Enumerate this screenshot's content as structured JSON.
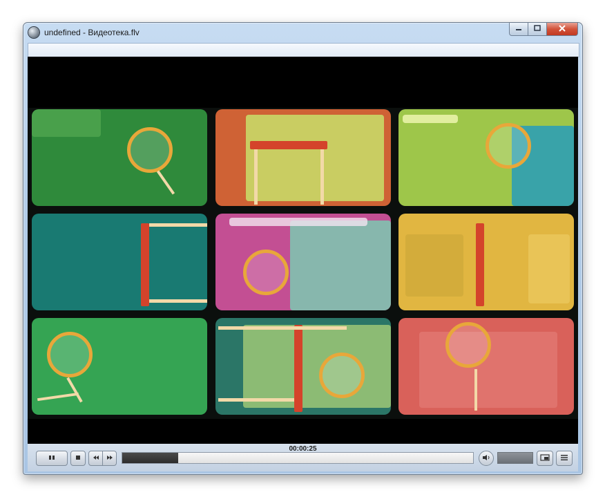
{
  "window": {
    "title": "undefined - Видеотека.flv",
    "buttons": {
      "minimize": "minimize-icon",
      "maximize": "maximize-icon",
      "close": "close-icon"
    }
  },
  "player": {
    "timecode": "00:00:25",
    "progress_fraction": 0.16,
    "volume_fraction": 1.0,
    "controls": {
      "pause": "pause-icon",
      "stop": "stop-icon",
      "rewind": "rewind-icon",
      "forward": "forward-icon",
      "mute": "speaker-icon",
      "snapshot": "snapshot-icon",
      "playlist": "playlist-icon"
    }
  },
  "colors": {
    "tile_1": "#2f8a3b",
    "tile_2": "#cf6235",
    "tile_3": "#9ec64a",
    "tile_4": "#197a72",
    "tile_5": "#c34f93",
    "tile_6": "#e1b641",
    "tile_7": "#35a453",
    "tile_8": "#2b7667",
    "tile_9": "#d9615a"
  }
}
